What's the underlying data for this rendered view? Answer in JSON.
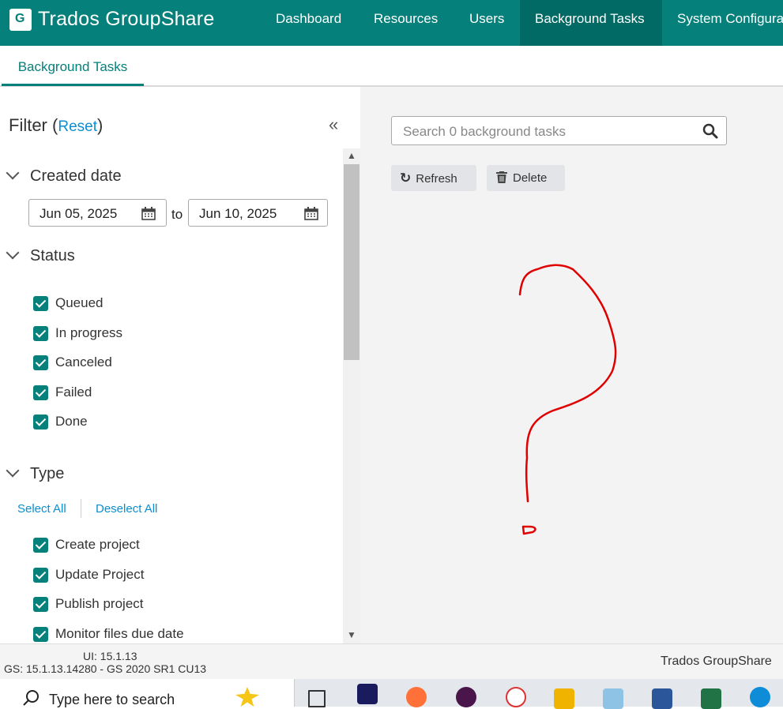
{
  "app": {
    "title": "Trados GroupShare",
    "logo_letter": "G",
    "nav": [
      "Dashboard",
      "Resources",
      "Users",
      "Background Tasks",
      "System Configura"
    ],
    "active_nav": "Background Tasks",
    "brand_color": "#05807a"
  },
  "tabs": {
    "active": "Background Tasks"
  },
  "filter": {
    "title": "Filter",
    "reset": "Reset",
    "created_date": {
      "label": "Created date",
      "from": "Jun 05, 2025",
      "to_label": "to",
      "to": "Jun 10, 2025"
    },
    "status": {
      "label": "Status",
      "items": [
        "Queued",
        "In progress",
        "Canceled",
        "Failed",
        "Done"
      ]
    },
    "type": {
      "label": "Type",
      "select_all": "Select All",
      "deselect_all": "Deselect All",
      "items": [
        "Create project",
        "Update Project",
        "Publish project",
        "Monitor files due date"
      ]
    }
  },
  "main": {
    "search_placeholder": "Search 0 background tasks",
    "refresh": "Refresh",
    "delete": "Delete"
  },
  "footer": {
    "ui_version": "UI: 15.1.13",
    "gs_version": "GS: 15.1.13.14280 - GS 2020 SR1 CU13",
    "brand": "Trados GroupShare"
  },
  "taskbar": {
    "search_placeholder": "Type here to search"
  }
}
